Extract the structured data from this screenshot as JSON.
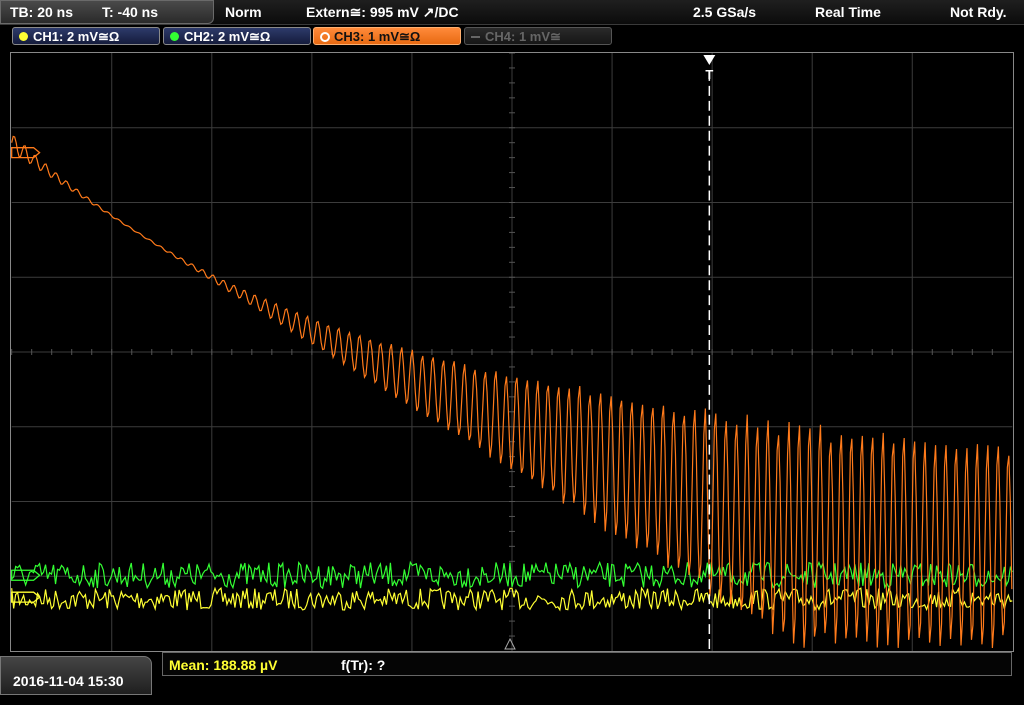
{
  "status": {
    "timebase": "TB: 20 ns",
    "trigger_time": "T: -40 ns",
    "mode": "Norm",
    "trigger_source": "Extern≅: 995 mV ↗/DC",
    "sample_rate": "2.5 GSa/s",
    "acquisition": "Real Time",
    "state": "Not Rdy."
  },
  "channels": [
    {
      "label": "CH1: 2 mV≅Ω",
      "color": "#ffff33",
      "state": "on"
    },
    {
      "label": "CH2: 2 mV≅Ω",
      "color": "#33ff33",
      "state": "on"
    },
    {
      "label": "CH3: 1 mV≅Ω",
      "color": "#ff7a1a",
      "state": "active"
    },
    {
      "label": "CH4: 1 mV≅",
      "color": "#777777",
      "state": "off"
    }
  ],
  "trigger_marker_label": "T",
  "footer": {
    "datetime": "2016-11-04  15:30",
    "measurement": "Mean: 188.88 µV",
    "function": "f(Tr): ?"
  },
  "colors": {
    "ch1": "#ffff33",
    "ch2": "#33ff33",
    "ch3": "#ff7a1a",
    "grid": "#3c3c3c",
    "trigger": "#ffffff"
  }
}
